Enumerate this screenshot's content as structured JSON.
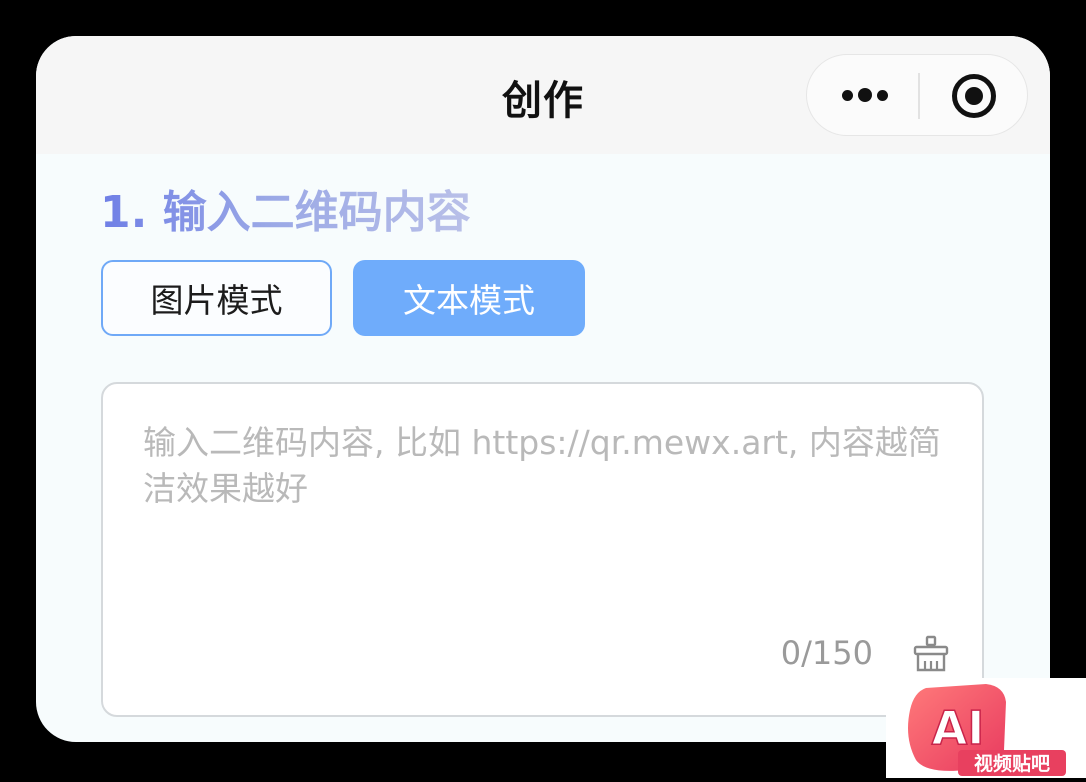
{
  "navbar": {
    "title": "创作",
    "more_icon": "more-dots-icon",
    "close_icon": "target-close-icon"
  },
  "section": {
    "title": "1. 输入二维码内容"
  },
  "modes": {
    "image_label": "图片模式",
    "text_label": "文本模式",
    "selected": "text"
  },
  "input": {
    "placeholder": "输入二维码内容, 比如 https://qr.mewx.art, 内容越简洁效果越好",
    "value": "",
    "counter": "0/150",
    "clear_icon": "broom-clear-icon"
  },
  "watermark": {
    "logo_text": "AI",
    "caption": "视频贴吧"
  },
  "colors": {
    "accent_blue": "#6facfb",
    "title_gradient_start": "#6f7fe6",
    "title_gradient_end": "#b9c0e8",
    "watermark_red": "#f0566d"
  }
}
